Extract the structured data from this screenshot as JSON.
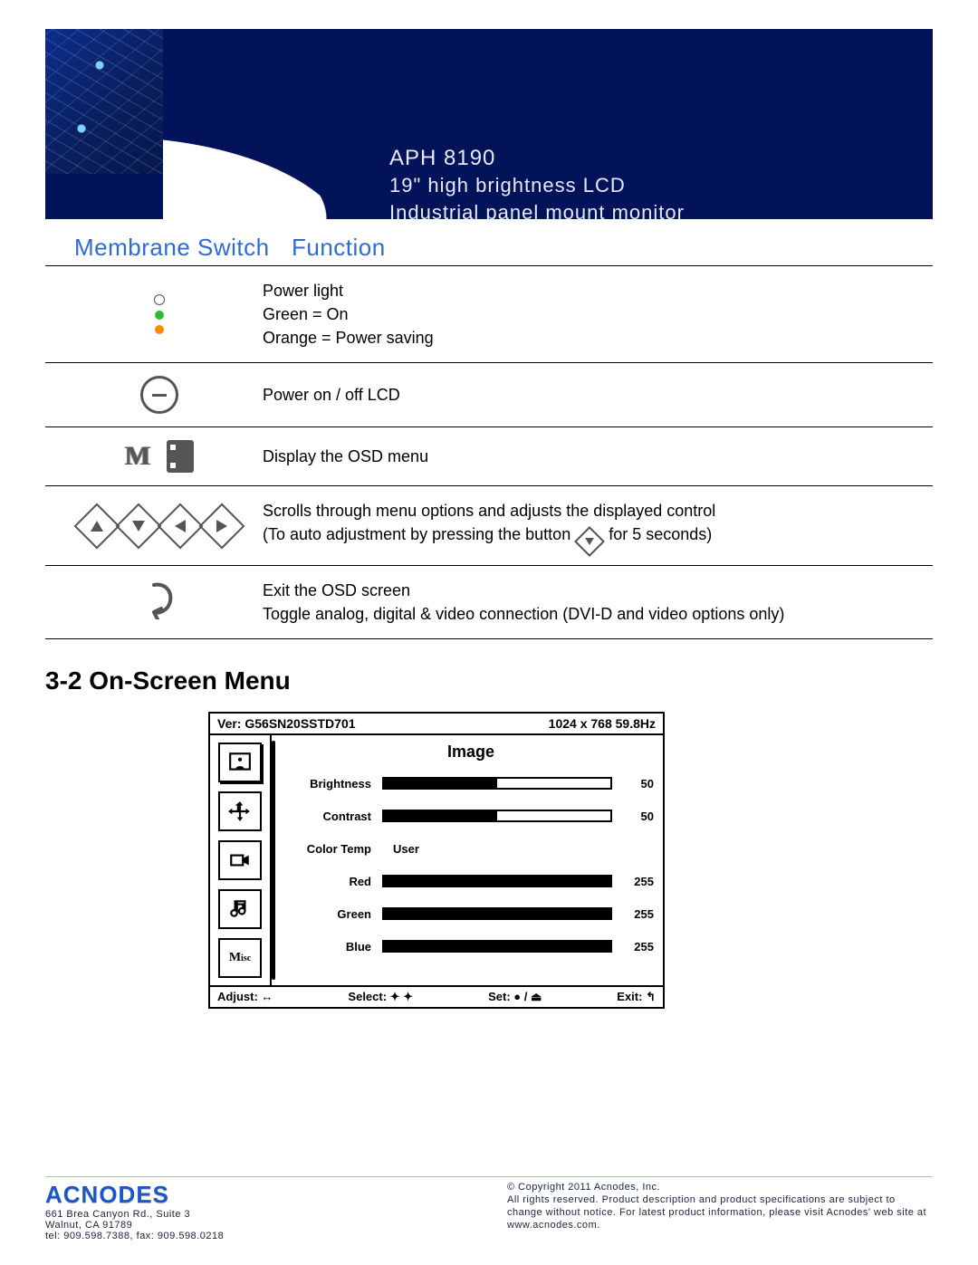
{
  "banner": {
    "model": "APH 8190",
    "line2": "19\" high brightness LCD",
    "line3": "Industrial panel mount monitor"
  },
  "table": {
    "head": {
      "c1": "Membrane Switch",
      "c2": "Function"
    },
    "row1": {
      "l1": "Power light",
      "l2": "Green = On",
      "l3": "Orange = Power saving"
    },
    "row2": "Power on / off LCD",
    "row3": "Display the OSD menu",
    "row4": {
      "l1": "Scrolls through menu options and adjusts the displayed control",
      "l2a": "(To auto adjustment by pressing the button",
      "l2b": " for 5 seconds)"
    },
    "row5": {
      "l1": "Exit the OSD screen",
      "l2": "Toggle analog, digital & video connection (DVI-D and video options only)"
    }
  },
  "section_head": "3-2  On-Screen Menu",
  "osd": {
    "ver": "Ver: G56SN20SSTD701",
    "res": "1024 x 768  59.8Hz",
    "title": "Image",
    "rows": {
      "brightness": {
        "label": "Brightness",
        "val": "50"
      },
      "contrast": {
        "label": "Contrast",
        "val": "50"
      },
      "colortemp": {
        "label": "Color Temp",
        "val": "User"
      },
      "red": {
        "label": "Red",
        "val": "255"
      },
      "green": {
        "label": "Green",
        "val": "255"
      },
      "blue": {
        "label": "Blue",
        "val": "255"
      }
    },
    "hint": {
      "adjust": "Adjust: ↔",
      "select": "Select: ✦ ✦",
      "set": "Set: ● / ⏏",
      "exit": "Exit: ↰"
    }
  },
  "footer": {
    "brand": "ACNODES",
    "addr1": "661 Brea Canyon Rd., Suite 3",
    "addr2": "Walnut, CA 91789",
    "addr3": "tel: 909.598.7388, fax: 909.598.0218",
    "copy": "© Copyright 2011 Acnodes, Inc.",
    "legal": "All rights reserved. Product description and product specifications are subject to change without notice. For latest product information, please visit Acnodes' web site at www.acnodes.com."
  }
}
